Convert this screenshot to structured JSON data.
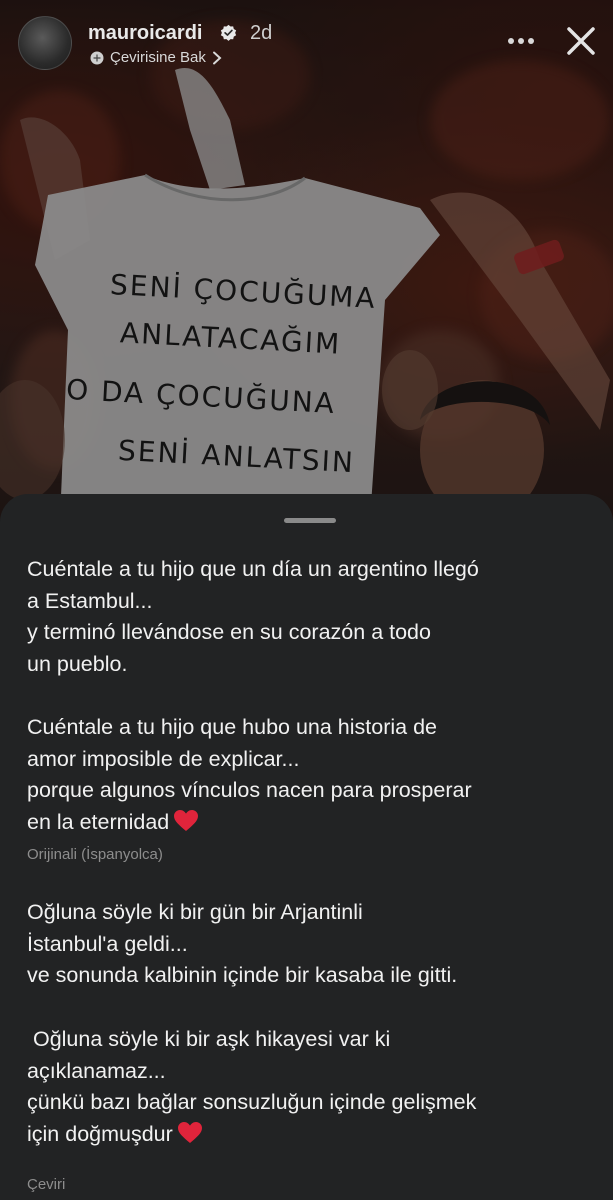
{
  "header": {
    "username": "mauroicardi",
    "time": "2d",
    "translate_link": "Çevirisine Bak",
    "icons": [
      "verified-badge-icon",
      "translate-icon",
      "chevron-right-icon",
      "more-icon",
      "close-icon"
    ]
  },
  "photo": {
    "shirt_lines": [
      "SENİ ÇOCUĞUMA",
      "ANLATACAĞIM",
      "O DA ÇOCUĞUNA",
      "SENİ ANLATSIN"
    ]
  },
  "sheet": {
    "original": {
      "paragraph_1": [
        "Cuéntale a tu hijo que un día un argentino llegó",
        "a Estambul...",
        "y terminó llevándose en su corazón a todo",
        "un pueblo."
      ],
      "paragraph_2": [
        "Cuéntale a tu hijo que hubo una historia de",
        "amor imposible de explicar...",
        "porque algunos vínculos nacen para prosperar",
        "en la eternidad"
      ],
      "label": "Orijinali (İspanyolca)"
    },
    "translation": {
      "paragraph_1": [
        "Oğluna söyle ki bir gün bir Arjantinli",
        "İstanbul'a geldi...",
        "ve sonunda kalbinin içinde bir kasaba ile gitti."
      ],
      "paragraph_2": [
        " Oğluna söyle ki bir aşk hikayesi var ki",
        "açıklanamaz...",
        "çünkü bazı bağlar sonsuzluğun içinde gelişmek",
        "için doğmuşdur"
      ],
      "label": "Çeviri"
    },
    "emoji": "heart-emoji-icon"
  },
  "colors": {
    "sheet_bg": "#222324",
    "text": "#f1f1f1",
    "muted": "#8d8d8d",
    "heart": "#e0243b"
  }
}
